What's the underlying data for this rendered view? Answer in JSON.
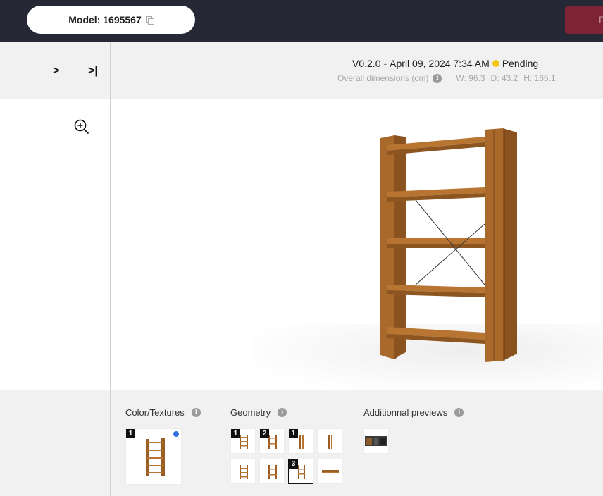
{
  "topbar": {
    "model_label": "Model: 1695567",
    "action_label": "R"
  },
  "nav": {
    "expand_label": ">",
    "expand_all_label": ">|"
  },
  "header": {
    "version": "V0.2.0",
    "separator": "-",
    "date": "April 09, 2024 7:34 AM",
    "status": "Pending",
    "status_color": "#f3c713",
    "dims_label": "Overall dimensions (cm)",
    "width": "W: 96.3",
    "depth": "D: 43.2",
    "height": "H: 165.1"
  },
  "sections": {
    "color_textures": {
      "title": "Color/Textures",
      "thumbs": [
        {
          "badge": "1",
          "has_dot": true
        }
      ]
    },
    "geometry": {
      "title": "Geometry",
      "thumbs": [
        {
          "badge": "1"
        },
        {
          "badge": "2"
        },
        {
          "badge": "1"
        },
        {
          "badge": ""
        },
        {
          "badge": ""
        },
        {
          "badge": ""
        },
        {
          "badge": "3",
          "selected": true
        },
        {
          "badge": ""
        }
      ]
    },
    "additional_previews": {
      "title": "Additionnal previews",
      "thumbs": [
        {
          "badge": ""
        }
      ]
    }
  },
  "colors": {
    "topbar_bg": "#262836",
    "accent_button": "#7d2333",
    "wood": "#a8692a",
    "selection_dot": "#2f6fe8"
  }
}
